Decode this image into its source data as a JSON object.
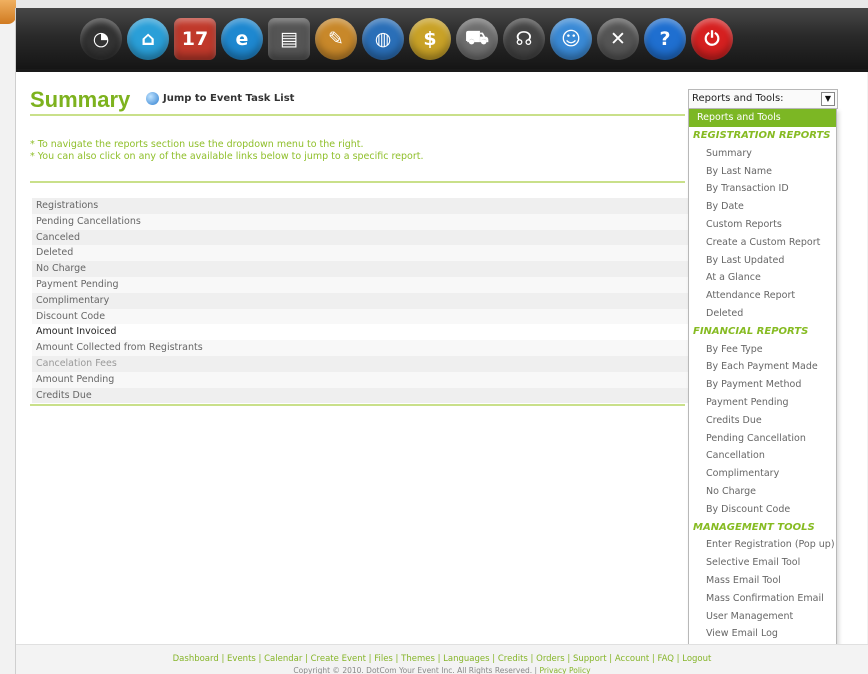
{
  "toolbar": {
    "icons": [
      {
        "name": "speedometer-icon",
        "glyph": "◔",
        "color": "#333333"
      },
      {
        "name": "home-icon",
        "glyph": "⌂",
        "color": "#2a9fd8"
      },
      {
        "name": "calendar-icon",
        "glyph": "17",
        "color": "#c0392b"
      },
      {
        "name": "create-event-icon",
        "glyph": "e",
        "color": "#1e88d0"
      },
      {
        "name": "files-icon",
        "glyph": "▤",
        "color": "#555555"
      },
      {
        "name": "themes-icon",
        "glyph": "✎",
        "color": "#c8882a"
      },
      {
        "name": "languages-icon",
        "glyph": "◍",
        "color": "#2a6fb8"
      },
      {
        "name": "credits-icon",
        "glyph": "$",
        "color": "#c9a227"
      },
      {
        "name": "orders-icon",
        "glyph": "⛟",
        "color": "#6f6f6f"
      },
      {
        "name": "support-icon",
        "glyph": "☊",
        "color": "#444444"
      },
      {
        "name": "account-icon",
        "glyph": "☺",
        "color": "#3a8ad6"
      },
      {
        "name": "tools-icon",
        "glyph": "✕",
        "color": "#555555"
      },
      {
        "name": "help-icon",
        "glyph": "?",
        "color": "#1f6fd0"
      },
      {
        "name": "logout-icon",
        "glyph": "⏻",
        "color": "#d62020"
      }
    ]
  },
  "page": {
    "title": "Summary",
    "jump_link": "Jump to Event Task List",
    "instructions": [
      "* To navigate the reports section use the dropdown menu to the right.",
      "* You can also click on any of the available links below to jump to a specific report."
    ]
  },
  "summary_rows": [
    "Registrations",
    "Pending Cancellations",
    "Canceled",
    "Deleted",
    "No Charge",
    "Payment Pending",
    "Complimentary",
    "Discount Code",
    "Amount Invoiced",
    "Amount Collected from Registrants",
    "Cancelation Fees",
    "Amount Pending",
    "Credits Due"
  ],
  "dropdown": {
    "label": "Reports and Tools:",
    "selected": "Reports and Tools",
    "sections": [
      {
        "heading": "REGISTRATION REPORTS",
        "items": [
          "Summary",
          "By Last Name",
          "By Transaction ID",
          "By Date",
          "Custom Reports",
          "Create a Custom Report",
          "By Last Updated",
          "At a Glance",
          "Attendance Report",
          "Deleted"
        ]
      },
      {
        "heading": "FINANCIAL REPORTS",
        "items": [
          "By Fee Type",
          "By Each Payment Made",
          "By Payment Method",
          "Payment Pending",
          "Credits Due",
          "Pending Cancellation",
          "Cancellation",
          "Complimentary",
          "No Charge",
          "By Discount Code"
        ]
      },
      {
        "heading": "MANAGEMENT TOOLS",
        "items": [
          "Enter Registration (Pop up)",
          "Selective Email Tool",
          "Mass Email Tool",
          "Mass Confirmation Email",
          "User Management",
          "View Email Log"
        ]
      }
    ]
  },
  "footer": {
    "links": [
      "Dashboard",
      "Events",
      "Calendar",
      "Create Event",
      "Files",
      "Themes",
      "Languages",
      "Credits",
      "Orders",
      "Support",
      "Account",
      "FAQ",
      "Logout"
    ],
    "copyright": "Copyright © 2010. DotCom Your Event Inc. All Rights Reserved.",
    "privacy": "Privacy Policy"
  },
  "colors": {
    "accent": "#7cb724",
    "heading": "#86bb22",
    "toolbar": "#2a2a2a"
  }
}
